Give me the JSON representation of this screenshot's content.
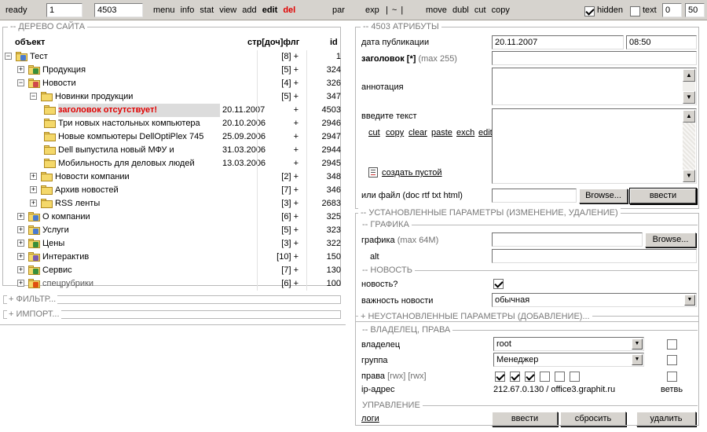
{
  "toolbar": {
    "status": "ready",
    "input1": "1",
    "input2": "4503",
    "links": [
      "menu",
      "info",
      "stat",
      "view",
      "add"
    ],
    "edit": "edit",
    "del": "del",
    "par": "par",
    "exp": "exp",
    "exp_sep": "| ~ |",
    "actions": [
      "move",
      "dubl",
      "cut",
      "copy"
    ],
    "hidden_label": "hidden",
    "hidden_checked": true,
    "text_label": "text",
    "text_checked": false,
    "from": "0",
    "count": "50"
  },
  "tree": {
    "legend": "-- ДЕРЕВО САЙТА",
    "col_object": "объект",
    "col_counts": "стр[доч]флг",
    "col_id": "id",
    "rows": [
      {
        "label": "Тест",
        "count": "[8] +",
        "id": "1",
        "level": 0,
        "toggle": "-",
        "mark": "home"
      },
      {
        "label": "Продукция",
        "count": "[5] +",
        "id": "324",
        "level": 1,
        "toggle": "+",
        "mark": "list"
      },
      {
        "label": "Новости",
        "count": "[4] +",
        "id": "326",
        "level": 1,
        "toggle": "-",
        "mark": "news"
      },
      {
        "label": "Новинки продукции",
        "count": "[5] +",
        "id": "347",
        "level": 2,
        "toggle": "-",
        "mark": ""
      },
      {
        "label": "заголовок отсутствует!",
        "date": "20.11.2007",
        "count": "+",
        "id": "4503",
        "level": 3,
        "selected": true,
        "red": true
      },
      {
        "label": "Три новых настольных компьютера",
        "date": "20.10.2006",
        "count": "+",
        "id": "2946",
        "level": 3
      },
      {
        "label": "Новые компьютеры DellOptiPlex 745",
        "date": "25.09.2006",
        "count": "+",
        "id": "2947",
        "level": 3
      },
      {
        "label": "Dell выпустила новый МФУ и",
        "date": "31.03.2006",
        "count": "+",
        "id": "2944",
        "level": 3
      },
      {
        "label": "Мобильность для деловых людей",
        "date": "13.03.2006",
        "count": "+",
        "id": "2945",
        "level": 3
      },
      {
        "label": "Новости компании",
        "count": "[2] +",
        "id": "348",
        "level": 2,
        "toggle": "+",
        "mark": ""
      },
      {
        "label": "Архив новостей",
        "count": "[7] +",
        "id": "346",
        "level": 2,
        "toggle": "+",
        "mark": ""
      },
      {
        "label": "RSS ленты",
        "count": "[3] +",
        "id": "2683",
        "level": 2,
        "toggle": "+",
        "mark": ""
      },
      {
        "label": "О компании",
        "count": "[6] +",
        "id": "325",
        "level": 1,
        "toggle": "+",
        "mark": "home"
      },
      {
        "label": "Услуги",
        "count": "[5] +",
        "id": "323",
        "level": 1,
        "toggle": "+",
        "mark": "home"
      },
      {
        "label": "Цены",
        "count": "[3] +",
        "id": "322",
        "level": 1,
        "toggle": "+",
        "mark": "list"
      },
      {
        "label": "Интерактив",
        "count": "[10] +",
        "id": "150",
        "level": 1,
        "toggle": "+",
        "mark": "chart"
      },
      {
        "label": "Сервис",
        "count": "[7] +",
        "id": "130",
        "level": 1,
        "toggle": "+",
        "mark": "list"
      },
      {
        "label": "спецрубрики",
        "count": "[6] +",
        "id": "100",
        "level": 1,
        "toggle": "+",
        "mark": "star",
        "muted": true
      }
    ]
  },
  "filter_legend": "+ ФИЛЬТР...",
  "import_legend": "+ ИМПОРТ...",
  "attributes": {
    "legend": "-- 4503 АТРИБУТЫ",
    "pubdate_label": "дата публикации",
    "pubdate": "20.11.2007",
    "pubtime": "08:50",
    "title_label": "заголовок [*]",
    "title_hint": "(max 255)",
    "title_value": "",
    "annotation_label": "аннотация",
    "text_label": "введите текст",
    "edit_links": [
      "cut",
      "copy",
      "clear",
      "paste",
      "exch",
      "edit"
    ],
    "create_empty": "создать пустой",
    "file_label": "или файл (doc rtf txt html)",
    "browse": "Browse...",
    "submit": "ввести"
  },
  "installed_params": "-- УСТАНОВЛЕННЫЕ ПАРАМЕТРЫ (ИЗМЕНЕНИЕ, УДАЛЕНИЕ)",
  "graphics": {
    "legend": "-- ГРАФИКА",
    "label": "графика",
    "hint": "(max 64M)",
    "browse": "Browse...",
    "alt_label": "alt"
  },
  "news": {
    "legend": "-- НОВОСТЬ",
    "is_news_label": "новость?",
    "is_news": true,
    "importance_label": "важность новости",
    "importance": "обычная"
  },
  "uninstalled_params": "+ НЕУСТАНОВЛЕННЫЕ ПАРАМЕТРЫ (ДОБАВЛЕНИЕ)...",
  "owner": {
    "legend": "-- ВЛАДЕЛЕЦ, ПРАВА",
    "owner_label": "владелец",
    "owner": "root",
    "group_label": "группа",
    "group": "Менеджер",
    "rights_label": "права",
    "rights_hint": "[rwx] [rwx]",
    "rights": [
      true,
      true,
      true,
      false,
      false,
      false
    ],
    "ip_label": "ip-адрес",
    "ip_value": "212.67.0.130 / office3.graphit.ru",
    "branch_label": "ветвь"
  },
  "control": {
    "legend": "УПРАВЛЕНИЕ",
    "logs": "логи",
    "submit": "ввести",
    "reset": "сбросить",
    "delete": "удалить"
  }
}
